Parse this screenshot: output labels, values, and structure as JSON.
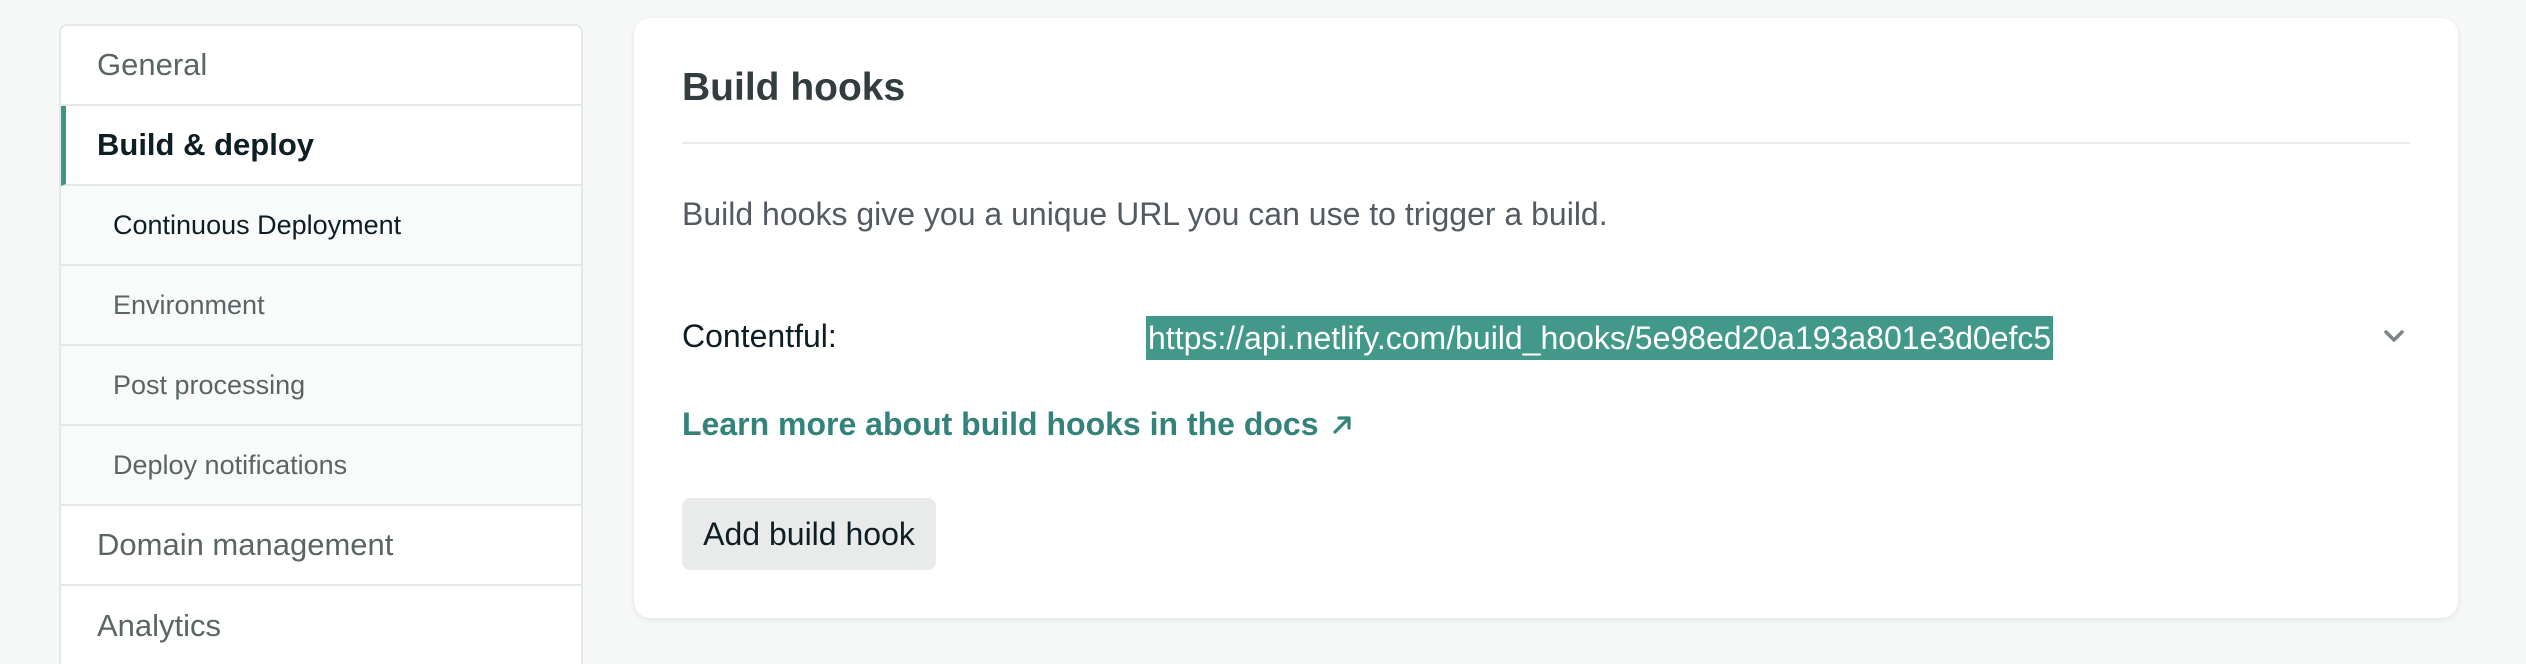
{
  "sidebar": {
    "general": "General",
    "build_deploy": "Build & deploy",
    "sub_items": [
      "Continuous Deployment",
      "Environment",
      "Post processing",
      "Deploy notifications"
    ],
    "domain_management": "Domain management",
    "analytics": "Analytics"
  },
  "build_hooks": {
    "title": "Build hooks",
    "description": "Build hooks give you a unique URL you can use to trigger a build.",
    "hooks": [
      {
        "name": "Contentful:",
        "url": "https://api.netlify.com/build_hooks/5e98ed20a193a801e3d0efc5"
      }
    ],
    "docs_link": "Learn more about build hooks in the docs",
    "add_button": "Add build hook"
  },
  "colors": {
    "accent": "#3b9686",
    "selection": "#42998a",
    "link": "#33837a"
  },
  "icons": {
    "hook_expand": "chevron-down-icon",
    "docs_link": "external-arrow-icon"
  }
}
